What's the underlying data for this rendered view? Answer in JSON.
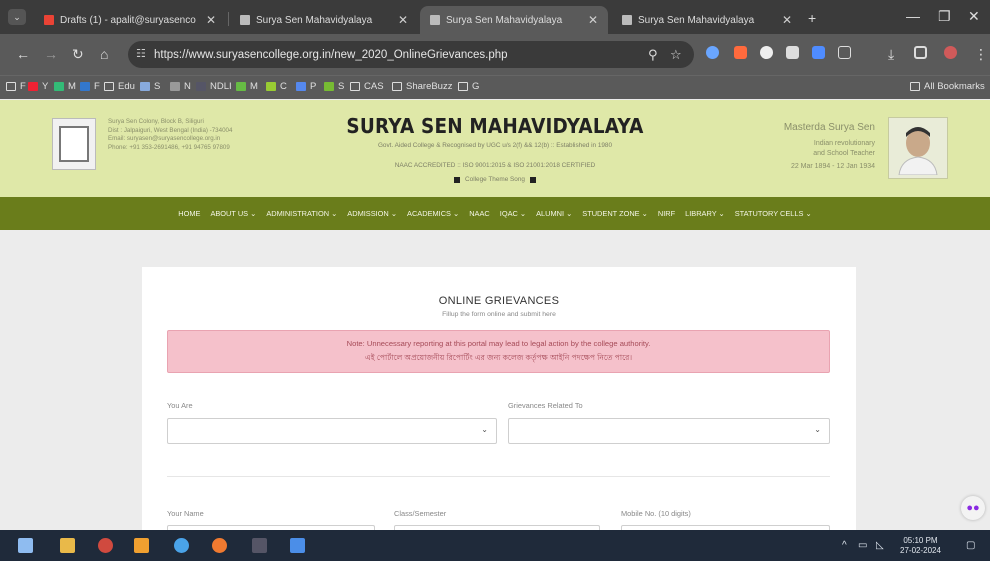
{
  "browser": {
    "tabs": [
      {
        "title": "Drafts (1) - apalit@suryasenco",
        "active": false
      },
      {
        "title": "Surya Sen Mahavidyalaya",
        "active": false
      },
      {
        "title": "Surya Sen Mahavidyalaya",
        "active": true
      },
      {
        "title": "Surya Sen Mahavidyalaya",
        "active": false
      }
    ],
    "new_tab": "+",
    "url": "https://www.suryasencollege.org.in/new_2020_OnlineGrievances.php",
    "bookmarks": [
      "F",
      "Y",
      "M",
      "F",
      "Edu",
      "S",
      "N",
      "NDLI",
      "M",
      "C",
      "P",
      "S",
      "CAS",
      "ShareBuzz",
      "G"
    ],
    "all_bookmarks": "All Bookmarks"
  },
  "header": {
    "contact_lines": [
      "Surya Sen Colony, Block B, Siliguri",
      "Dist : Jalpaiguri, West Bengal (India) -734004",
      "Email: suryasen@suryasencollege.org.in",
      "Phone: +91 353-2691486, +91 94765 97809"
    ],
    "college_name": "SURYA SEN MAHAVIDYALAYA",
    "affiliation": "Govt. Aided College & Recognised by UGC u/s 2(f) && 12(b) :: Established in 1980",
    "accreditation": "NAAC ACCREDITED  ::  ISO 9001:2015 & ISO 21001:2018 CERTIFIED",
    "theme_song": "College Theme Song",
    "portrait_title": "Masterda Surya Sen",
    "portrait_desc_1": "Indian revolutionary",
    "portrait_desc_2": "and School Teacher",
    "portrait_dates": "22 Mar 1894 - 12 Jan 1934"
  },
  "nav": [
    "HOME",
    "ABOUT US ⌄",
    "ADMINISTRATION ⌄",
    "ADMISSION ⌄",
    "ACADEMICS ⌄",
    "NAAC",
    "IQAC ⌄",
    "ALUMNI ⌄",
    "STUDENT ZONE ⌄",
    "NIRF",
    "LIBRARY ⌄",
    "STATUTORY CELLS ⌄"
  ],
  "form": {
    "title": "ONLINE GRIEVANCES",
    "subtitle": "Fillup the form online and submit here",
    "note_en": "Note: Unnecessary reporting at this portal may lead to legal action by the college authority.",
    "note_bn": "এই পোর্টালে অপ্রয়োজনীয় রিপোর্টিং এর জন্য কলেজ কর্তৃপক্ষ আইনি পদক্ষেপ নিতে পারে।",
    "you_are_label": "You Are",
    "grievance_label": "Grievances Related To",
    "name_label": "Your Name",
    "class_label": "Class/Semester",
    "mobile_label": "Mobile No. (10 digits)"
  },
  "taskbar": {
    "time": "05:10 PM",
    "date": "27-02-2024"
  },
  "colors": {
    "header_bg": "#dfe8a8",
    "nav_bg": "#6a7d1b",
    "alert_bg": "#f5c1cb",
    "alert_text": "#a64b58"
  }
}
